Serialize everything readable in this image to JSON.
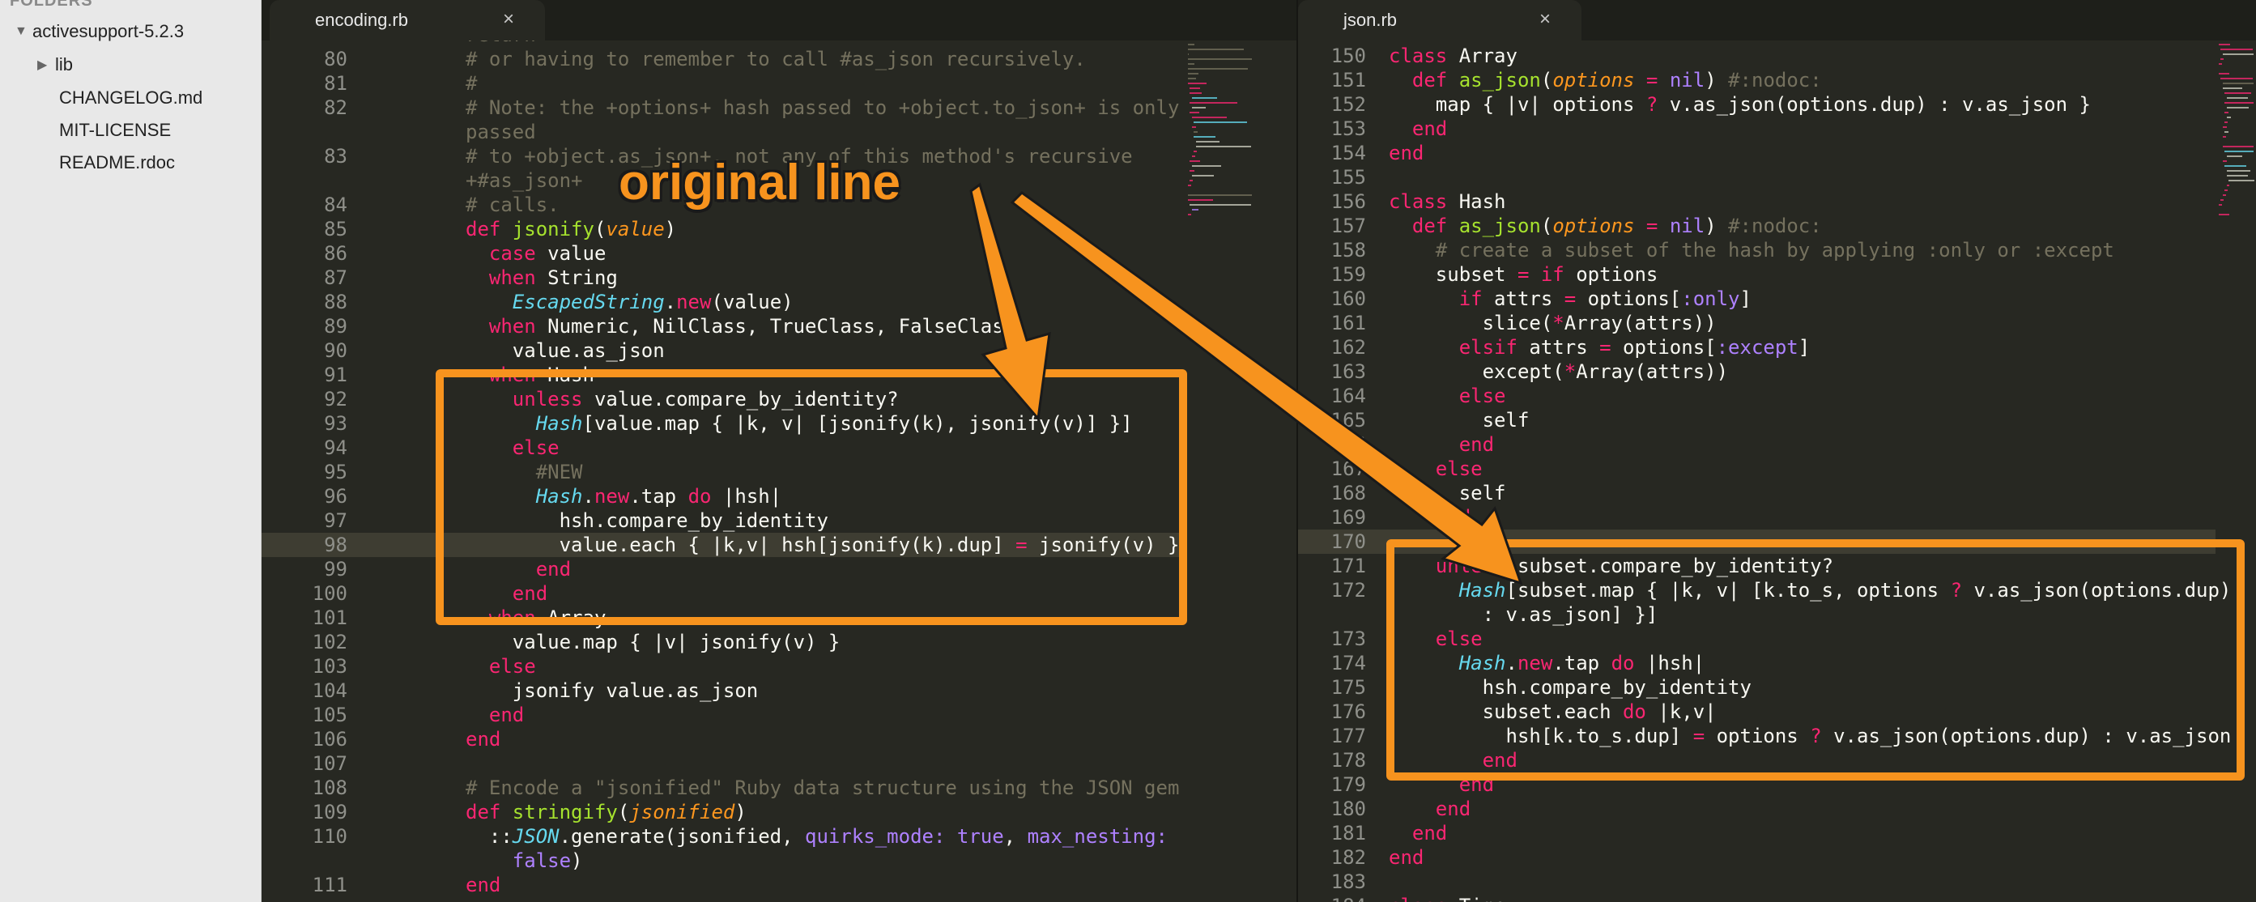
{
  "sidebar": {
    "header": "FOLDERS",
    "items": [
      {
        "label": "activesupport-5.2.3",
        "icon": "triangle-down-icon"
      },
      {
        "label": "lib",
        "icon": "triangle-right-icon"
      },
      {
        "label": "CHANGELOG.md"
      },
      {
        "label": "MIT-LICENSE"
      },
      {
        "label": "README.rdoc"
      }
    ]
  },
  "tabs": [
    {
      "label": "encoding.rb",
      "close": "×"
    },
    {
      "label": "json.rb",
      "close": "×"
    }
  ],
  "annotation": {
    "text": "original line",
    "color": "#f7931e"
  },
  "colors": {
    "background": "#272822",
    "keyword": "#f92672",
    "function": "#a6e22e",
    "comment": "#75715e",
    "type": "#66d9ef",
    "param": "#fd971f",
    "symbol": "#ae81ff",
    "highlight": "#f7931e"
  },
  "left_editor": {
    "lines": [
      {
        "n": "",
        "segs": [
          {
            "c": "c",
            "t": "return"
          }
        ]
      },
      {
        "n": "80",
        "segs": [
          {
            "c": "c",
            "t": "# or having to remember to call #as_json recursively."
          }
        ]
      },
      {
        "n": "81",
        "segs": [
          {
            "c": "c",
            "t": "#"
          }
        ]
      },
      {
        "n": "82",
        "segs": [
          {
            "c": "c",
            "t": "# Note: the +options+ hash passed to +object.to_json+ is only"
          }
        ]
      },
      {
        "n": "",
        "segs": [
          {
            "c": "c",
            "t": "passed"
          }
        ]
      },
      {
        "n": "83",
        "segs": [
          {
            "c": "c",
            "t": "# to +object.as_json+, not any of this method's recursive"
          }
        ]
      },
      {
        "n": "",
        "segs": [
          {
            "c": "c",
            "t": "+#as_json+"
          }
        ]
      },
      {
        "n": "84",
        "segs": [
          {
            "c": "c",
            "t": "# calls."
          }
        ]
      },
      {
        "n": "85",
        "segs": [
          {
            "c": "k",
            "t": "def "
          },
          {
            "c": "f",
            "t": "jsonify"
          },
          {
            "c": "",
            "t": "("
          },
          {
            "c": "p",
            "t": "value"
          },
          {
            "c": "",
            "t": ")"
          }
        ]
      },
      {
        "n": "86",
        "segs": [
          {
            "c": "k",
            "t": "  case "
          },
          {
            "c": "",
            "t": "value"
          }
        ]
      },
      {
        "n": "87",
        "segs": [
          {
            "c": "k",
            "t": "  when "
          },
          {
            "c": "",
            "t": "String"
          }
        ]
      },
      {
        "n": "88",
        "segs": [
          {
            "c": "",
            "t": "    "
          },
          {
            "c": "t",
            "t": "EscapedString"
          },
          {
            "c": "",
            "t": "."
          },
          {
            "c": "k",
            "t": "new"
          },
          {
            "c": "",
            "t": "(value)"
          }
        ]
      },
      {
        "n": "89",
        "segs": [
          {
            "c": "k",
            "t": "  when "
          },
          {
            "c": "",
            "t": "Numeric, NilClass, TrueClass, FalseClass"
          }
        ]
      },
      {
        "n": "90",
        "segs": [
          {
            "c": "",
            "t": "    value.as_json"
          }
        ]
      },
      {
        "n": "91",
        "segs": [
          {
            "c": "k",
            "t": "  when "
          },
          {
            "c": "",
            "t": "Hash"
          }
        ]
      },
      {
        "n": "92",
        "segs": [
          {
            "c": "k",
            "t": "    unless "
          },
          {
            "c": "",
            "t": "value.compare_by_identity?"
          }
        ]
      },
      {
        "n": "93",
        "segs": [
          {
            "c": "",
            "t": "      "
          },
          {
            "c": "t",
            "t": "Hash"
          },
          {
            "c": "",
            "t": "[value.map { |k, v| [jsonify(k), jsonify(v)] }]"
          }
        ]
      },
      {
        "n": "94",
        "segs": [
          {
            "c": "k",
            "t": "    else"
          }
        ]
      },
      {
        "n": "95",
        "segs": [
          {
            "c": "",
            "t": "      "
          },
          {
            "c": "c",
            "t": "#NEW"
          }
        ]
      },
      {
        "n": "96",
        "segs": [
          {
            "c": "",
            "t": "      "
          },
          {
            "c": "t",
            "t": "Hash"
          },
          {
            "c": "",
            "t": "."
          },
          {
            "c": "k",
            "t": "new"
          },
          {
            "c": "",
            "t": ".tap "
          },
          {
            "c": "k",
            "t": "do"
          },
          {
            "c": "",
            "t": " |hsh|"
          }
        ]
      },
      {
        "n": "97",
        "segs": [
          {
            "c": "",
            "t": "        hsh.compare_by_identity"
          }
        ]
      },
      {
        "n": "98",
        "segs": [
          {
            "c": "",
            "t": "        value.each { |k,v| hsh[jsonify(k).dup] "
          },
          {
            "c": "k",
            "t": "="
          },
          {
            "c": "",
            "t": " jsonify(v) }"
          }
        ]
      },
      {
        "n": "99",
        "segs": [
          {
            "c": "k",
            "t": "      end"
          }
        ]
      },
      {
        "n": "100",
        "segs": [
          {
            "c": "k",
            "t": "    end"
          }
        ]
      },
      {
        "n": "101",
        "segs": [
          {
            "c": "k",
            "t": "  when "
          },
          {
            "c": "",
            "t": "Array"
          }
        ]
      },
      {
        "n": "102",
        "segs": [
          {
            "c": "",
            "t": "    value.map { |v| jsonify(v) }"
          }
        ]
      },
      {
        "n": "103",
        "segs": [
          {
            "c": "k",
            "t": "  else"
          }
        ]
      },
      {
        "n": "104",
        "segs": [
          {
            "c": "",
            "t": "    jsonify value.as_json"
          }
        ]
      },
      {
        "n": "105",
        "segs": [
          {
            "c": "k",
            "t": "  end"
          }
        ]
      },
      {
        "n": "106",
        "segs": [
          {
            "c": "k",
            "t": "end"
          }
        ]
      },
      {
        "n": "107",
        "segs": [
          {
            "c": "",
            "t": ""
          }
        ]
      },
      {
        "n": "108",
        "segs": [
          {
            "c": "c",
            "t": "# Encode a \"jsonified\" Ruby data structure using the JSON gem"
          }
        ]
      },
      {
        "n": "109",
        "segs": [
          {
            "c": "k",
            "t": "def "
          },
          {
            "c": "f",
            "t": "stringify"
          },
          {
            "c": "",
            "t": "("
          },
          {
            "c": "p",
            "t": "jsonified"
          },
          {
            "c": "",
            "t": ")"
          }
        ]
      },
      {
        "n": "110",
        "segs": [
          {
            "c": "",
            "t": "  ::"
          },
          {
            "c": "t",
            "t": "JSON"
          },
          {
            "c": "",
            "t": ".generate(jsonified, "
          },
          {
            "c": "y",
            "t": "quirks_mode:"
          },
          {
            "c": "",
            "t": " "
          },
          {
            "c": "y",
            "t": "true"
          },
          {
            "c": "",
            "t": ", "
          },
          {
            "c": "y",
            "t": "max_nesting:"
          }
        ]
      },
      {
        "n": "",
        "segs": [
          {
            "c": "",
            "t": "    "
          },
          {
            "c": "y",
            "t": "false"
          },
          {
            "c": "",
            "t": ")"
          }
        ]
      },
      {
        "n": "111",
        "segs": [
          {
            "c": "k",
            "t": "end"
          }
        ]
      }
    ]
  },
  "right_editor": {
    "lines": [
      {
        "n": "150",
        "segs": [
          {
            "c": "k",
            "t": "class "
          },
          {
            "c": "",
            "t": "Array"
          }
        ]
      },
      {
        "n": "151",
        "segs": [
          {
            "c": "k",
            "t": "  def "
          },
          {
            "c": "f",
            "t": "as_json"
          },
          {
            "c": "",
            "t": "("
          },
          {
            "c": "p",
            "t": "options"
          },
          {
            "c": "",
            "t": " "
          },
          {
            "c": "k",
            "t": "="
          },
          {
            "c": "",
            "t": " "
          },
          {
            "c": "y",
            "t": "nil"
          },
          {
            "c": "",
            "t": ") "
          },
          {
            "c": "c",
            "t": "#:nodoc:"
          }
        ]
      },
      {
        "n": "152",
        "segs": [
          {
            "c": "",
            "t": "    map { |v| options "
          },
          {
            "c": "k",
            "t": "?"
          },
          {
            "c": "",
            "t": " v.as_json(options.dup) : v.as_json }"
          }
        ]
      },
      {
        "n": "153",
        "segs": [
          {
            "c": "k",
            "t": "  end"
          }
        ]
      },
      {
        "n": "154",
        "segs": [
          {
            "c": "k",
            "t": "end"
          }
        ]
      },
      {
        "n": "155",
        "segs": [
          {
            "c": "",
            "t": ""
          }
        ]
      },
      {
        "n": "156",
        "segs": [
          {
            "c": "k",
            "t": "class "
          },
          {
            "c": "",
            "t": "Hash"
          }
        ]
      },
      {
        "n": "157",
        "segs": [
          {
            "c": "k",
            "t": "  def "
          },
          {
            "c": "f",
            "t": "as_json"
          },
          {
            "c": "",
            "t": "("
          },
          {
            "c": "p",
            "t": "options"
          },
          {
            "c": "",
            "t": " "
          },
          {
            "c": "k",
            "t": "="
          },
          {
            "c": "",
            "t": " "
          },
          {
            "c": "y",
            "t": "nil"
          },
          {
            "c": "",
            "t": ") "
          },
          {
            "c": "c",
            "t": "#:nodoc:"
          }
        ]
      },
      {
        "n": "158",
        "segs": [
          {
            "c": "",
            "t": "    "
          },
          {
            "c": "c",
            "t": "# create a subset of the hash by applying :only or :except"
          }
        ]
      },
      {
        "n": "159",
        "segs": [
          {
            "c": "",
            "t": "    subset "
          },
          {
            "c": "k",
            "t": "="
          },
          {
            "c": "",
            "t": " "
          },
          {
            "c": "k",
            "t": "if"
          },
          {
            "c": "",
            "t": " options"
          }
        ]
      },
      {
        "n": "160",
        "segs": [
          {
            "c": "k",
            "t": "      if"
          },
          {
            "c": "",
            "t": " attrs "
          },
          {
            "c": "k",
            "t": "="
          },
          {
            "c": "",
            "t": " options["
          },
          {
            "c": "y",
            "t": ":only"
          },
          {
            "c": "",
            "t": "]"
          }
        ]
      },
      {
        "n": "161",
        "segs": [
          {
            "c": "",
            "t": "        slice("
          },
          {
            "c": "k",
            "t": "*"
          },
          {
            "c": "",
            "t": "Array(attrs))"
          }
        ]
      },
      {
        "n": "162",
        "segs": [
          {
            "c": "k",
            "t": "      elsif"
          },
          {
            "c": "",
            "t": " attrs "
          },
          {
            "c": "k",
            "t": "="
          },
          {
            "c": "",
            "t": " options["
          },
          {
            "c": "y",
            "t": ":except"
          },
          {
            "c": "",
            "t": "]"
          }
        ]
      },
      {
        "n": "163",
        "segs": [
          {
            "c": "",
            "t": "        except("
          },
          {
            "c": "k",
            "t": "*"
          },
          {
            "c": "",
            "t": "Array(attrs))"
          }
        ]
      },
      {
        "n": "164",
        "segs": [
          {
            "c": "k",
            "t": "      else"
          }
        ]
      },
      {
        "n": "165",
        "segs": [
          {
            "c": "",
            "t": "        self"
          }
        ]
      },
      {
        "n": "166",
        "segs": [
          {
            "c": "k",
            "t": "      end"
          }
        ]
      },
      {
        "n": "167",
        "segs": [
          {
            "c": "k",
            "t": "    else"
          }
        ]
      },
      {
        "n": "168",
        "segs": [
          {
            "c": "",
            "t": "      self"
          }
        ]
      },
      {
        "n": "169",
        "segs": [
          {
            "c": "k",
            "t": "    end"
          }
        ]
      },
      {
        "n": "170",
        "segs": [
          {
            "c": "",
            "t": ""
          }
        ]
      },
      {
        "n": "171",
        "segs": [
          {
            "c": "k",
            "t": "    unless"
          },
          {
            "c": "",
            "t": " subset.compare_by_identity?"
          }
        ]
      },
      {
        "n": "172",
        "segs": [
          {
            "c": "",
            "t": "      "
          },
          {
            "c": "t",
            "t": "Hash"
          },
          {
            "c": "",
            "t": "[subset.map { |k, v| [k.to_s, options "
          },
          {
            "c": "k",
            "t": "?"
          },
          {
            "c": "",
            "t": " v.as_json(options.dup)"
          }
        ]
      },
      {
        "n": "",
        "segs": [
          {
            "c": "",
            "t": "        : v.as_json] }]"
          }
        ]
      },
      {
        "n": "173",
        "segs": [
          {
            "c": "k",
            "t": "    else"
          }
        ]
      },
      {
        "n": "174",
        "segs": [
          {
            "c": "",
            "t": "      "
          },
          {
            "c": "t",
            "t": "Hash"
          },
          {
            "c": "",
            "t": "."
          },
          {
            "c": "k",
            "t": "new"
          },
          {
            "c": "",
            "t": ".tap "
          },
          {
            "c": "k",
            "t": "do"
          },
          {
            "c": "",
            "t": " |hsh|"
          }
        ]
      },
      {
        "n": "175",
        "segs": [
          {
            "c": "",
            "t": "        hsh.compare_by_identity"
          }
        ]
      },
      {
        "n": "176",
        "segs": [
          {
            "c": "",
            "t": "        subset.each "
          },
          {
            "c": "k",
            "t": "do"
          },
          {
            "c": "",
            "t": " |k,v|"
          }
        ]
      },
      {
        "n": "177",
        "segs": [
          {
            "c": "",
            "t": "          hsh[k.to_s.dup] "
          },
          {
            "c": "k",
            "t": "="
          },
          {
            "c": "",
            "t": " options "
          },
          {
            "c": "k",
            "t": "?"
          },
          {
            "c": "",
            "t": " v.as_json(options.dup) : v.as_json"
          }
        ]
      },
      {
        "n": "178",
        "segs": [
          {
            "c": "k",
            "t": "        end"
          }
        ]
      },
      {
        "n": "179",
        "segs": [
          {
            "c": "k",
            "t": "      end"
          }
        ]
      },
      {
        "n": "180",
        "segs": [
          {
            "c": "k",
            "t": "    end"
          }
        ]
      },
      {
        "n": "181",
        "segs": [
          {
            "c": "k",
            "t": "  end"
          }
        ]
      },
      {
        "n": "182",
        "segs": [
          {
            "c": "k",
            "t": "end"
          }
        ]
      },
      {
        "n": "183",
        "segs": [
          {
            "c": "",
            "t": ""
          }
        ]
      },
      {
        "n": "184",
        "segs": [
          {
            "c": "k",
            "t": "class "
          },
          {
            "c": "",
            "t": "Time"
          }
        ]
      }
    ]
  }
}
